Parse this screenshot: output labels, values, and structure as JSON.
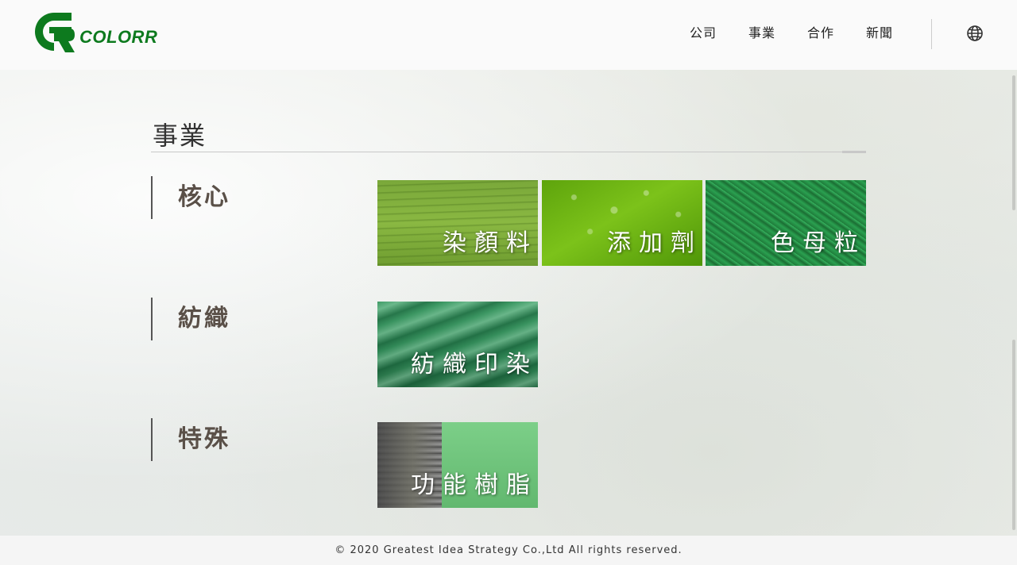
{
  "header": {
    "logo_text": "COLORR",
    "nav": [
      "公司",
      "事業",
      "合作",
      "新聞"
    ]
  },
  "page": {
    "title": "事業"
  },
  "categories": [
    {
      "label": "核心",
      "tiles": [
        "染顏料",
        "添加劑",
        "色母粒"
      ]
    },
    {
      "label": "紡織",
      "tiles": [
        "紡織印染"
      ]
    },
    {
      "label": "特殊",
      "tiles": [
        "功能樹脂"
      ]
    }
  ],
  "footer": {
    "copyright": "© 2020 Greatest Idea Strategy Co.,Ltd All rights reserved."
  },
  "colors": {
    "brand_green": "#0d7a1e",
    "text_dark": "#333333",
    "label_brown": "#5a5048"
  },
  "icons": {
    "logo": "gr-logo-icon",
    "language": "globe-icon"
  }
}
